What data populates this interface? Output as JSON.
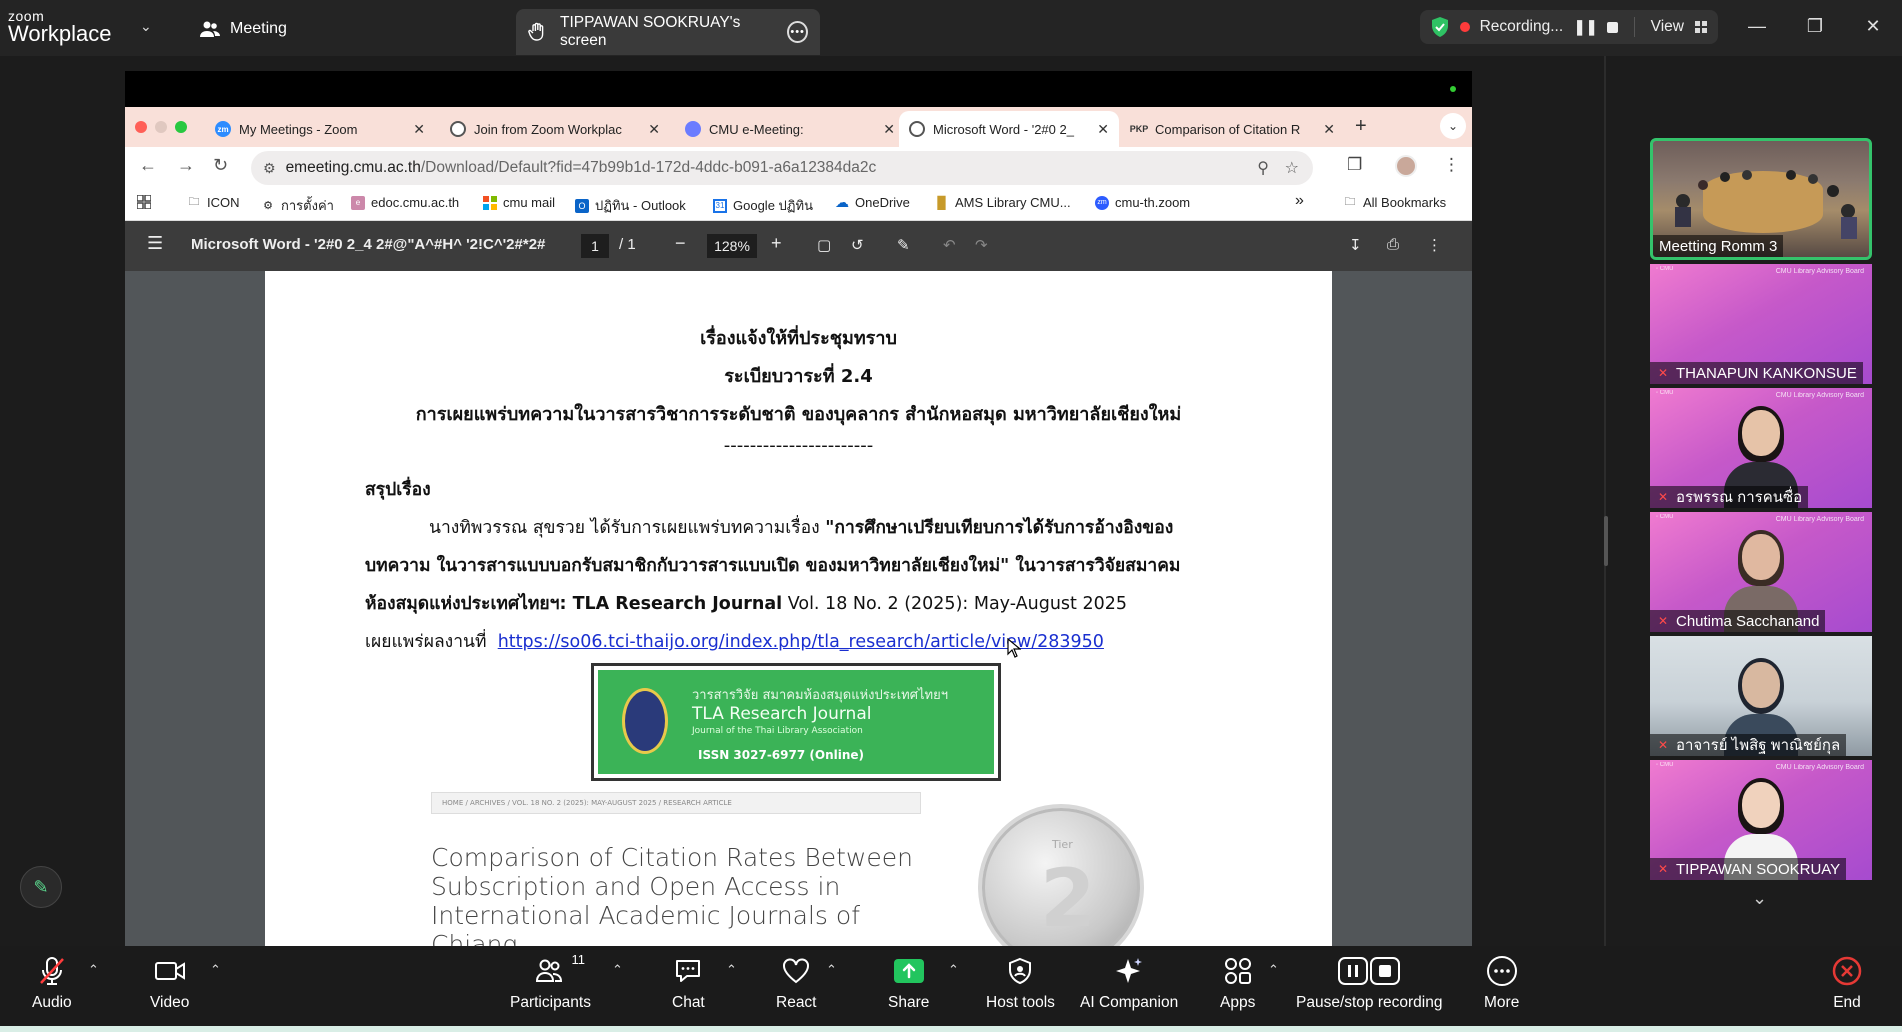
{
  "zoom": {
    "logo_small": "zoom",
    "logo_big": "Workplace",
    "meeting_label": "Meeting",
    "screen_tab_label": "TIPPAWAN SOOKRUAY's screen",
    "recording_label": "Recording...",
    "view_label": "View"
  },
  "browser": {
    "tabs": [
      {
        "title": "My Meetings - Zoom",
        "favicon": "zm",
        "color": "#2d8cff"
      },
      {
        "title": "Join from Zoom Workplac",
        "favicon": "globe",
        "color": "#555555"
      },
      {
        "title": "CMU e-Meeting:",
        "favicon": "cmu",
        "color": "#6b7cff"
      },
      {
        "title": "Microsoft Word - '2#0 2_",
        "favicon": "globe",
        "color": "#555555",
        "active": true
      },
      {
        "title": "Comparison of Citation R",
        "favicon": "PKP",
        "color": "#333333"
      }
    ],
    "url_host": "emeeting.cmu.ac.th",
    "url_path": "/Download/Default?fid=47b99b1d-172d-4ddc-b091-a6a12384da2c",
    "bookmarks": [
      {
        "label": "ICON",
        "icon": "folder-icon"
      },
      {
        "label": "การตั้งค่า",
        "icon": "gear-icon"
      },
      {
        "label": "edoc.cmu.ac.th",
        "icon": "edoc-icon"
      },
      {
        "label": "cmu mail",
        "icon": "windows-icon"
      },
      {
        "label": "ปฏิทิน - Outlook",
        "icon": "outlook-icon"
      },
      {
        "label": "Google ปฏิทิน",
        "icon": "calendar-icon"
      },
      {
        "label": "OneDrive",
        "icon": "onedrive-icon"
      },
      {
        "label": "AMS Library CMU...",
        "icon": "ams-icon"
      },
      {
        "label": "cmu-th.zoom",
        "icon": "zoom-icon"
      }
    ],
    "more_bookmarks": "»",
    "all_bookmarks": "All Bookmarks"
  },
  "pdf": {
    "title": "Microsoft Word - '2#0 2_4  2#@\"A^#H^  '2!C^'2#*2#",
    "page_current": "1",
    "page_total": "/  1",
    "zoom": "128%",
    "line1": "เรื่องแจ้งให้ที่ประชุมทราบ",
    "line2": "ระเบียบวาระที่ 2.4",
    "line3": "การเผยแพร่บทความในวารสารวิชาการระดับชาติ ของบุคลากร สำนักหอสมุด มหาวิทยาลัยเชียงใหม่",
    "line4": "-----------------------",
    "summary_heading": "สรุปเรื่อง",
    "para1_normal": "นางทิพวรรณ สุขรวย ได้รับการเผยแพร่บทความเรื่อง ",
    "para1_bold": "\"การศึกษาเปรียบเทียบการได้รับการอ้างอิงของ",
    "para2_bold": "บทความ ในวารสารแบบบอกรับสมาชิกกับวารสารแบบเปิด ของมหาวิทยาลัยเชียงใหม่\" ในวารสารวิจัยสมาคม",
    "para3_bold": "ห้องสมุดแห่งประเทศไทยฯ: TLA Research Journal",
    "para3_normal": " Vol. 18 No. 2 (2025): May-August 2025",
    "para4_label": "เผยแพร่ผลงานที่",
    "link": "https://so06.tci-thaijo.org/index.php/tla_research/article/view/283950",
    "banner_th": "วารสารวิจัย สมาคมห้องสมุดแห่งประเทศไทยฯ",
    "banner_en": "TLA Research Journal",
    "banner_sub": "Journal of the Thai Library Association",
    "banner_issn": "ISSN 3027-6977 (Online)",
    "breadcrumb": "HOME  /  ARCHIVES  /  VOL. 18 NO. 2 (2025): MAY-AUGUST 2025  /  RESEARCH ARTICLE",
    "article_title": "Comparison of Citation Rates Between Subscription and Open Access in International Academic Journals of Chiang",
    "coin_tier": "Tier",
    "coin_number": "2"
  },
  "gallery": {
    "tiles": [
      {
        "name": "Meetting Romm 3",
        "type": "room",
        "muted": false
      },
      {
        "name": "THANAPUN KANKONSUE",
        "type": "empty",
        "muted": true
      },
      {
        "name": "อรพรรณ การคนซื่อ",
        "type": "person",
        "muted": true
      },
      {
        "name": "Chutima  Sacchanand",
        "type": "person",
        "muted": true
      },
      {
        "name": "อาจารย์ ไพสิฐ พาณิชย์กุล",
        "type": "office",
        "muted": true
      },
      {
        "name": "TIPPAWAN SOOKRUAY",
        "type": "person",
        "muted": true
      }
    ],
    "tile_brand": "CMU Library Advisory Board"
  },
  "toolbar": {
    "audio": "Audio",
    "video": "Video",
    "participants": "Participants",
    "participants_count": "11",
    "chat": "Chat",
    "react": "React",
    "share": "Share",
    "host_tools": "Host tools",
    "ai_companion": "AI Companion",
    "apps": "Apps",
    "pause_stop_recording": "Pause/stop recording",
    "more": "More",
    "end": "End"
  },
  "colors": {
    "zoom_green": "#34c36b",
    "share_green": "#22c55e",
    "end_red": "#e53935",
    "chrome_tab_strip": "#f9e0d9",
    "link_blue": "#1a2fd0"
  }
}
